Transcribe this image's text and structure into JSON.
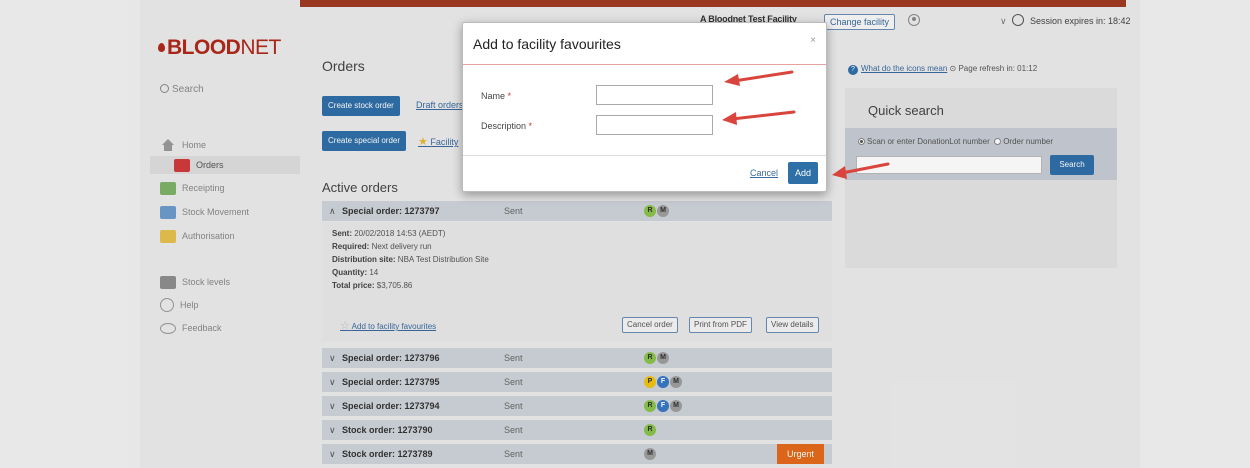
{
  "header": {
    "facility_label": "A Bloodnet Test Facility",
    "change_facility": "Change facility",
    "session_text": "Session expires in: 18:42"
  },
  "brand": {
    "logo_main": "BLOOD",
    "logo_net": "NET"
  },
  "sidebar": {
    "search": "Search",
    "items": [
      {
        "label": "Home"
      },
      {
        "label": "Orders"
      },
      {
        "label": "Receipting"
      },
      {
        "label": "Stock Movement"
      },
      {
        "label": "Authorisation"
      },
      {
        "label": "Stock levels"
      },
      {
        "label": "Help"
      },
      {
        "label": "Feedback"
      }
    ]
  },
  "main": {
    "title": "Orders",
    "create_stock_order": "Create stock order",
    "draft_orders": "Draft orders",
    "create_special_order": "Create special order",
    "facility_favourites": "Facility",
    "active_orders_title": "Active orders",
    "expanded_order": {
      "name": "Special order: 1273797",
      "status": "Sent",
      "pills": [
        "R",
        "M"
      ],
      "sent": "20/02/2018 14:53 (AEDT)",
      "required": "Next delivery run",
      "distribution_site": "NBA Test Distribution Site",
      "quantity": "14",
      "total_price": "$3,705.86",
      "labels": {
        "sent": "Sent:",
        "required": "Required:",
        "distribution_site": "Distribution site:",
        "quantity": "Quantity:",
        "total_price": "Total price:"
      },
      "add_to_favourites": "Add to facility favourites",
      "cancel_order": "Cancel order",
      "print_pdf": "Print from PDF",
      "view_details": "View details"
    },
    "orders": [
      {
        "name": "Special order: 1273796",
        "status": "Sent",
        "pills": [
          "R",
          "M"
        ]
      },
      {
        "name": "Special order: 1273795",
        "status": "Sent",
        "pills": [
          "P",
          "F",
          "M"
        ]
      },
      {
        "name": "Special order: 1273794",
        "status": "Sent",
        "pills": [
          "R",
          "F",
          "M"
        ]
      },
      {
        "name": "Stock order: 1273790",
        "status": "Sent",
        "pills": [
          "R"
        ]
      },
      {
        "name": "Stock order: 1273789",
        "status": "Sent",
        "pills": [
          "M"
        ],
        "badge": "Urgent"
      }
    ]
  },
  "right_panel": {
    "help_link": "What do the icons mean",
    "page_refresh": "Page refresh in: 01:12",
    "quick_search_title": "Quick search",
    "radio_option_1": "Scan or enter DonationLot number",
    "radio_option_2": "Order number",
    "search_button": "Search"
  },
  "modal": {
    "title": "Add to facility favourites",
    "close": "×",
    "name_label": "Name",
    "description_label": "Description",
    "required_marker": "*",
    "name_value": "",
    "description_value": "",
    "cancel": "Cancel",
    "add": "Add"
  },
  "colors": {
    "brand_red": "#b0291b",
    "primary_blue": "#2f6fa8",
    "urgent_orange": "#e46a1a",
    "annotation_red": "#d9443c"
  }
}
